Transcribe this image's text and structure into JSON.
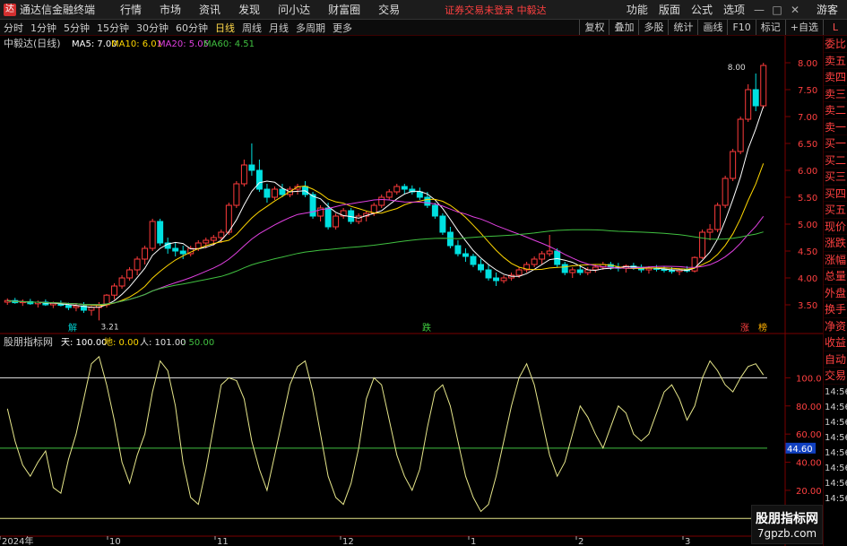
{
  "titlebar": {
    "app_title": "通达信金融终端",
    "menu": [
      "行情",
      "市场",
      "资讯",
      "发现",
      "问小达",
      "财富圈",
      "交易"
    ],
    "warning": "证券交易未登录  中毅达",
    "right_menu": [
      "功能",
      "版面",
      "公式",
      "选项"
    ],
    "user": "游客"
  },
  "toolbar": {
    "periods": [
      "分时",
      "1分钟",
      "5分钟",
      "15分钟",
      "30分钟",
      "60分钟",
      "日线",
      "周线",
      "月线",
      "多周期",
      "更多"
    ],
    "active_period": "日线",
    "right_buttons": [
      "复权",
      "叠加",
      "多股",
      "统计",
      "画线",
      "F10",
      "标记",
      "+自选"
    ],
    "L": "L"
  },
  "main_chart": {
    "label": "中毅达(日线)",
    "ma5": "MA5: 7.00",
    "ma10": "MA10: 6.01",
    "ma20": "MA20: 5.05",
    "ma60": "MA60: 4.51",
    "price_ticks": [
      "8.00",
      "7.50",
      "7.00",
      "6.50",
      "6.00",
      "5.50",
      "5.00",
      "4.50",
      "4.00",
      "3.50"
    ],
    "high_label": "8.00",
    "low_label": "3.21",
    "markers": [
      "解",
      "跌",
      "涨",
      "榜"
    ]
  },
  "indicator": {
    "label": "股朋指标网",
    "tian": "天: 100.00",
    "di": "地: 0.00",
    "ren": "人: 101.00",
    "val": ": 50.00",
    "ticks": [
      "100.0",
      "80.00",
      "60.00",
      "40.00",
      "20.00"
    ],
    "current": "44.60"
  },
  "xaxis": [
    "2024年",
    "10",
    "11",
    "12",
    "1",
    "2",
    "3"
  ],
  "side": [
    "委比",
    "卖五",
    "卖四",
    "卖三",
    "卖二",
    "卖一",
    "买一",
    "买二",
    "买三",
    "买四",
    "买五",
    "现价",
    "涨跌",
    "涨幅",
    "总量",
    "外盘",
    "换手",
    "净资",
    "收益",
    "自动",
    "交易"
  ],
  "side_times": [
    "14:56",
    "14:56",
    "14:56",
    "14:56",
    "14:56",
    "14:56",
    "14:56",
    "14:56"
  ],
  "watermark": {
    "line1": "股朋指标网",
    "line2": "7gpzb.com"
  },
  "colors": {
    "up": "#ff3b3b",
    "down": "#00e0e0",
    "ma5": "#ffffff",
    "ma10": "#ffd700",
    "ma20": "#e040e0",
    "ma60": "#40c040",
    "osc": "#e6e68a"
  },
  "chart_data": {
    "type": "candlestick",
    "y_range": [
      3.0,
      8.2
    ],
    "candles": [
      [
        3.55,
        3.62,
        3.5,
        3.58
      ],
      [
        3.58,
        3.63,
        3.52,
        3.54
      ],
      [
        3.54,
        3.6,
        3.48,
        3.56
      ],
      [
        3.56,
        3.61,
        3.5,
        3.52
      ],
      [
        3.52,
        3.58,
        3.45,
        3.55
      ],
      [
        3.55,
        3.6,
        3.48,
        3.5
      ],
      [
        3.5,
        3.56,
        3.44,
        3.53
      ],
      [
        3.53,
        3.58,
        3.47,
        3.49
      ],
      [
        3.49,
        3.54,
        3.4,
        3.45
      ],
      [
        3.45,
        3.52,
        3.38,
        3.48
      ],
      [
        3.48,
        3.55,
        3.35,
        3.4
      ],
      [
        3.4,
        3.48,
        3.3,
        3.45
      ],
      [
        3.45,
        3.55,
        3.21,
        3.5
      ],
      [
        3.5,
        3.7,
        3.45,
        3.68
      ],
      [
        3.68,
        3.9,
        3.6,
        3.85
      ],
      [
        3.85,
        4.05,
        3.8,
        4.0
      ],
      [
        4.0,
        4.2,
        3.95,
        4.15
      ],
      [
        4.15,
        4.4,
        4.05,
        4.35
      ],
      [
        4.35,
        4.6,
        4.25,
        4.55
      ],
      [
        4.55,
        5.1,
        4.5,
        5.05
      ],
      [
        5.05,
        5.1,
        4.6,
        4.65
      ],
      [
        4.65,
        4.75,
        4.45,
        4.55
      ],
      [
        4.55,
        4.65,
        4.4,
        4.5
      ],
      [
        4.5,
        4.6,
        4.35,
        4.45
      ],
      [
        4.45,
        4.6,
        4.4,
        4.55
      ],
      [
        4.55,
        4.7,
        4.5,
        4.65
      ],
      [
        4.65,
        4.75,
        4.55,
        4.7
      ],
      [
        4.7,
        4.8,
        4.6,
        4.75
      ],
      [
        4.75,
        4.9,
        4.65,
        4.85
      ],
      [
        4.85,
        5.4,
        4.8,
        5.35
      ],
      [
        5.35,
        5.8,
        5.3,
        5.75
      ],
      [
        5.75,
        6.2,
        5.7,
        6.1
      ],
      [
        6.1,
        6.5,
        5.9,
        6.0
      ],
      [
        6.0,
        6.2,
        5.6,
        5.65
      ],
      [
        5.65,
        5.75,
        5.4,
        5.5
      ],
      [
        5.5,
        5.7,
        5.45,
        5.65
      ],
      [
        5.65,
        5.75,
        5.5,
        5.55
      ],
      [
        5.55,
        5.7,
        5.5,
        5.65
      ],
      [
        5.65,
        5.75,
        5.55,
        5.7
      ],
      [
        5.7,
        5.8,
        5.5,
        5.55
      ],
      [
        5.55,
        5.6,
        5.1,
        5.15
      ],
      [
        5.15,
        5.35,
        5.05,
        5.3
      ],
      [
        5.3,
        5.4,
        4.9,
        4.95
      ],
      [
        4.95,
        5.2,
        4.9,
        5.15
      ],
      [
        5.15,
        5.3,
        5.1,
        5.25
      ],
      [
        5.25,
        5.3,
        5.0,
        5.05
      ],
      [
        5.05,
        5.2,
        5.0,
        5.15
      ],
      [
        5.15,
        5.25,
        5.05,
        5.2
      ],
      [
        5.2,
        5.4,
        5.15,
        5.35
      ],
      [
        5.35,
        5.55,
        5.3,
        5.5
      ],
      [
        5.5,
        5.65,
        5.45,
        5.6
      ],
      [
        5.6,
        5.75,
        5.55,
        5.7
      ],
      [
        5.7,
        5.75,
        5.55,
        5.65
      ],
      [
        5.65,
        5.72,
        5.55,
        5.6
      ],
      [
        5.6,
        5.68,
        5.45,
        5.5
      ],
      [
        5.5,
        5.6,
        5.3,
        5.35
      ],
      [
        5.35,
        5.4,
        5.1,
        5.15
      ],
      [
        5.15,
        5.2,
        4.8,
        4.85
      ],
      [
        4.85,
        4.95,
        4.55,
        4.6
      ],
      [
        4.6,
        4.7,
        4.4,
        4.45
      ],
      [
        4.45,
        4.55,
        4.3,
        4.4
      ],
      [
        4.4,
        4.45,
        4.2,
        4.25
      ],
      [
        4.25,
        4.35,
        4.1,
        4.15
      ],
      [
        4.15,
        4.25,
        3.95,
        4.0
      ],
      [
        4.0,
        4.1,
        3.85,
        3.95
      ],
      [
        3.95,
        4.05,
        3.9,
        4.0
      ],
      [
        4.0,
        4.1,
        3.95,
        4.05
      ],
      [
        4.05,
        4.2,
        4.0,
        4.15
      ],
      [
        4.15,
        4.3,
        4.1,
        4.25
      ],
      [
        4.25,
        4.4,
        4.2,
        4.35
      ],
      [
        4.35,
        4.5,
        4.25,
        4.45
      ],
      [
        4.45,
        4.8,
        4.4,
        4.5
      ],
      [
        4.5,
        4.55,
        4.2,
        4.25
      ],
      [
        4.25,
        4.3,
        4.05,
        4.1
      ],
      [
        4.1,
        4.2,
        4.0,
        4.15
      ],
      [
        4.15,
        4.25,
        4.05,
        4.1
      ],
      [
        4.1,
        4.2,
        4.05,
        4.15
      ],
      [
        4.15,
        4.25,
        4.1,
        4.2
      ],
      [
        4.2,
        4.3,
        4.15,
        4.25
      ],
      [
        4.25,
        4.3,
        4.15,
        4.2
      ],
      [
        4.2,
        4.28,
        4.12,
        4.18
      ],
      [
        4.18,
        4.25,
        4.1,
        4.22
      ],
      [
        4.22,
        4.28,
        4.15,
        4.2
      ],
      [
        4.2,
        4.25,
        4.1,
        4.15
      ],
      [
        4.15,
        4.22,
        4.08,
        4.18
      ],
      [
        4.18,
        4.24,
        4.12,
        4.16
      ],
      [
        4.16,
        4.22,
        4.1,
        4.14
      ],
      [
        4.14,
        4.2,
        4.08,
        4.12
      ],
      [
        4.12,
        4.18,
        4.05,
        4.15
      ],
      [
        4.15,
        4.22,
        4.1,
        4.13
      ],
      [
        4.13,
        4.4,
        4.1,
        4.38
      ],
      [
        4.38,
        4.9,
        4.35,
        4.85
      ],
      [
        4.85,
        5.0,
        4.7,
        4.9
      ],
      [
        4.9,
        5.4,
        4.85,
        5.35
      ],
      [
        5.35,
        5.9,
        5.3,
        5.85
      ],
      [
        5.85,
        6.4,
        5.8,
        6.35
      ],
      [
        6.35,
        7.0,
        6.3,
        6.95
      ],
      [
        6.95,
        7.6,
        6.9,
        7.5
      ],
      [
        7.5,
        7.8,
        7.1,
        7.2
      ],
      [
        7.2,
        8.0,
        7.15,
        7.95
      ]
    ],
    "osc": [
      78,
      55,
      38,
      30,
      40,
      48,
      22,
      18,
      42,
      60,
      85,
      110,
      115,
      95,
      70,
      40,
      25,
      45,
      60,
      90,
      112,
      105,
      80,
      40,
      15,
      10,
      35,
      65,
      95,
      100,
      98,
      85,
      55,
      35,
      20,
      45,
      70,
      95,
      108,
      112,
      90,
      60,
      30,
      15,
      10,
      25,
      50,
      85,
      100,
      95,
      70,
      45,
      30,
      20,
      35,
      65,
      90,
      95,
      80,
      55,
      30,
      15,
      5,
      10,
      30,
      55,
      80,
      100,
      110,
      95,
      70,
      45,
      30,
      40,
      60,
      80,
      72,
      60,
      50,
      65,
      80,
      75,
      60,
      55,
      60,
      75,
      90,
      95,
      85,
      70,
      80,
      100,
      112,
      105,
      95,
      90,
      100,
      108,
      110,
      102
    ]
  }
}
